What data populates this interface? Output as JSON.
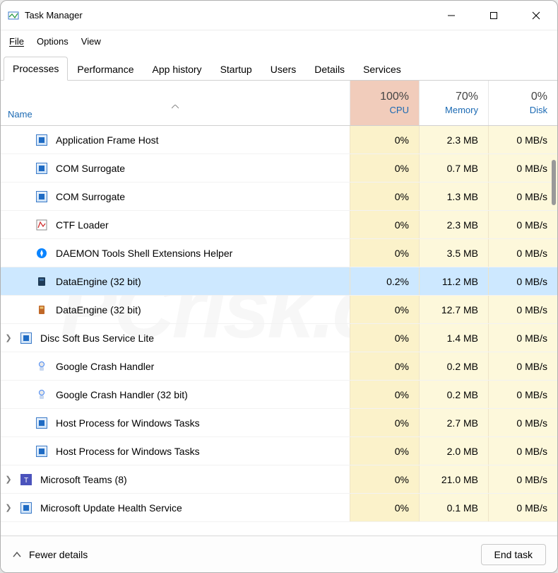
{
  "title": "Task Manager",
  "menus": {
    "file": "File",
    "options": "Options",
    "view": "View"
  },
  "tabs": {
    "processes": "Processes",
    "performance": "Performance",
    "app_history": "App history",
    "startup": "Startup",
    "users": "Users",
    "details": "Details",
    "services": "Services"
  },
  "columns": {
    "name": "Name",
    "cpu_pct": "100%",
    "cpu_lbl": "CPU",
    "mem_pct": "70%",
    "mem_lbl": "Memory",
    "disk_pct": "0%",
    "disk_lbl": "Disk"
  },
  "rows": [
    {
      "name": "Application Frame Host",
      "cpu": "0%",
      "mem": "2.3 MB",
      "disk": "0 MB/s",
      "icon": "blue-square",
      "expandable": false,
      "selected": false
    },
    {
      "name": "COM Surrogate",
      "cpu": "0%",
      "mem": "0.7 MB",
      "disk": "0 MB/s",
      "icon": "blue-square",
      "expandable": false,
      "selected": false
    },
    {
      "name": "COM Surrogate",
      "cpu": "0%",
      "mem": "1.3 MB",
      "disk": "0 MB/s",
      "icon": "blue-square",
      "expandable": false,
      "selected": false
    },
    {
      "name": "CTF Loader",
      "cpu": "0%",
      "mem": "2.3 MB",
      "disk": "0 MB/s",
      "icon": "ctf",
      "expandable": false,
      "selected": false
    },
    {
      "name": "DAEMON Tools Shell Extensions Helper",
      "cpu": "0%",
      "mem": "3.5 MB",
      "disk": "0 MB/s",
      "icon": "daemon",
      "expandable": false,
      "selected": false
    },
    {
      "name": "DataEngine (32 bit)",
      "cpu": "0.2%",
      "mem": "11.2 MB",
      "disk": "0 MB/s",
      "icon": "data1",
      "expandable": false,
      "selected": true
    },
    {
      "name": "DataEngine (32 bit)",
      "cpu": "0%",
      "mem": "12.7 MB",
      "disk": "0 MB/s",
      "icon": "data2",
      "expandable": false,
      "selected": false
    },
    {
      "name": "Disc Soft Bus Service Lite",
      "cpu": "0%",
      "mem": "1.4 MB",
      "disk": "0 MB/s",
      "icon": "blue-square",
      "expandable": true,
      "selected": false
    },
    {
      "name": "Google Crash Handler",
      "cpu": "0%",
      "mem": "0.2 MB",
      "disk": "0 MB/s",
      "icon": "google",
      "expandable": false,
      "selected": false
    },
    {
      "name": "Google Crash Handler (32 bit)",
      "cpu": "0%",
      "mem": "0.2 MB",
      "disk": "0 MB/s",
      "icon": "google",
      "expandable": false,
      "selected": false
    },
    {
      "name": "Host Process for Windows Tasks",
      "cpu": "0%",
      "mem": "2.7 MB",
      "disk": "0 MB/s",
      "icon": "blue-square",
      "expandable": false,
      "selected": false
    },
    {
      "name": "Host Process for Windows Tasks",
      "cpu": "0%",
      "mem": "2.0 MB",
      "disk": "0 MB/s",
      "icon": "blue-square",
      "expandable": false,
      "selected": false
    },
    {
      "name": "Microsoft Teams (8)",
      "cpu": "0%",
      "mem": "21.0 MB",
      "disk": "0 MB/s",
      "icon": "teams",
      "expandable": true,
      "selected": false
    },
    {
      "name": "Microsoft Update Health Service",
      "cpu": "0%",
      "mem": "0.1 MB",
      "disk": "0 MB/s",
      "icon": "blue-square",
      "expandable": true,
      "selected": false
    }
  ],
  "footer": {
    "fewer": "Fewer details",
    "end_task": "End task"
  }
}
